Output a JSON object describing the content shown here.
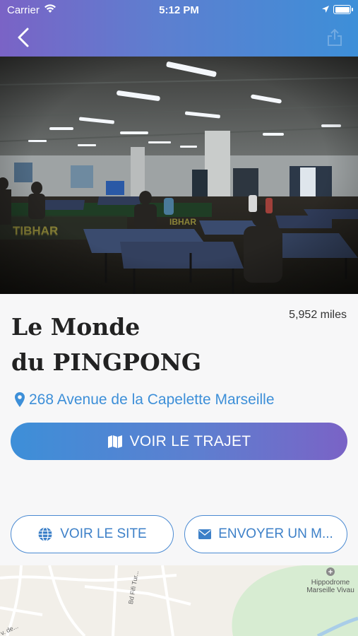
{
  "status_bar": {
    "carrier": "Carrier",
    "time": "5:12 PM"
  },
  "header": {
    "back_icon": "chevron-left-icon",
    "share_icon": "share-icon"
  },
  "place": {
    "name_line1": "Le Monde",
    "name_line2": "du PINGPONG",
    "distance": "5,952 miles",
    "address": "268 Avenue de la Capelette Marseille"
  },
  "actions": {
    "route_label": "VOIR LE TRAJET",
    "site_label": "VOIR LE SITE",
    "mail_label": "ENVOYER UN M..."
  },
  "map": {
    "poi_line1": "Hippodrome",
    "poi_line2": "Marseille Vivau",
    "road1": "Bd Fifi Tur...",
    "road2": "v. de..."
  },
  "colors": {
    "accent_blue": "#3d8fd8",
    "accent_purple": "#7a63c6",
    "title_text": "#222222"
  }
}
